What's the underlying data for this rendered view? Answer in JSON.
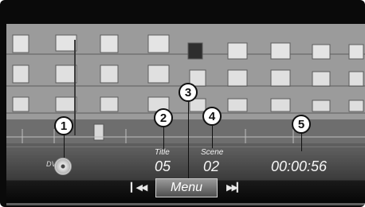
{
  "player": {
    "source_label": "DVD",
    "title_label": "Title",
    "title_value": "05",
    "scene_label": "Scene",
    "scene_value": "02",
    "time_value": "00:00:56",
    "menu_label": "Menu"
  },
  "controls": {
    "prev_icon": "skip-previous-icon",
    "next_icon": "skip-next-icon",
    "prev_glyph": "▎◀◀",
    "next_glyph": "▶▶▎"
  },
  "callouts": [
    "1",
    "2",
    "3",
    "4",
    "5"
  ],
  "colors": {
    "frame": "#0a0a0a",
    "text": "#f2f2f2",
    "menu_button": "#7a7a7a"
  }
}
